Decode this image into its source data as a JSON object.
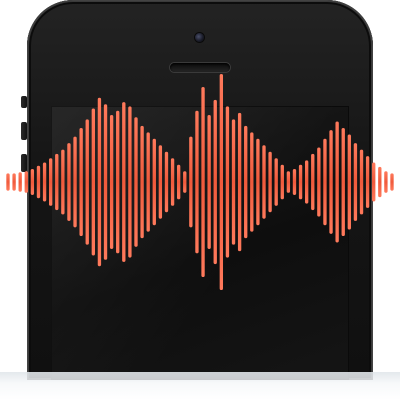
{
  "colors": {
    "waveform_bar": "#f05a3c",
    "waveform_bar_light": "#ff7a5c",
    "phone_body": "#151515",
    "screen": "#0e0e0e"
  },
  "icons": {
    "front_camera": "camera-icon",
    "earpiece": "speaker-icon"
  },
  "waveform": {
    "amplitudes": [
      0.08,
      0.08,
      0.09,
      0.1,
      0.12,
      0.15,
      0.18,
      0.22,
      0.26,
      0.3,
      0.36,
      0.42,
      0.5,
      0.58,
      0.68,
      0.78,
      0.72,
      0.62,
      0.66,
      0.74,
      0.7,
      0.6,
      0.52,
      0.46,
      0.4,
      0.34,
      0.28,
      0.22,
      0.16,
      0.1,
      0.42,
      0.66,
      0.88,
      0.62,
      0.76,
      1.0,
      0.7,
      0.58,
      0.64,
      0.52,
      0.46,
      0.4,
      0.34,
      0.28,
      0.22,
      0.16,
      0.1,
      0.12,
      0.16,
      0.2,
      0.26,
      0.32,
      0.4,
      0.48,
      0.56,
      0.5,
      0.44,
      0.36,
      0.3,
      0.24,
      0.18,
      0.14,
      0.1,
      0.08
    ]
  }
}
